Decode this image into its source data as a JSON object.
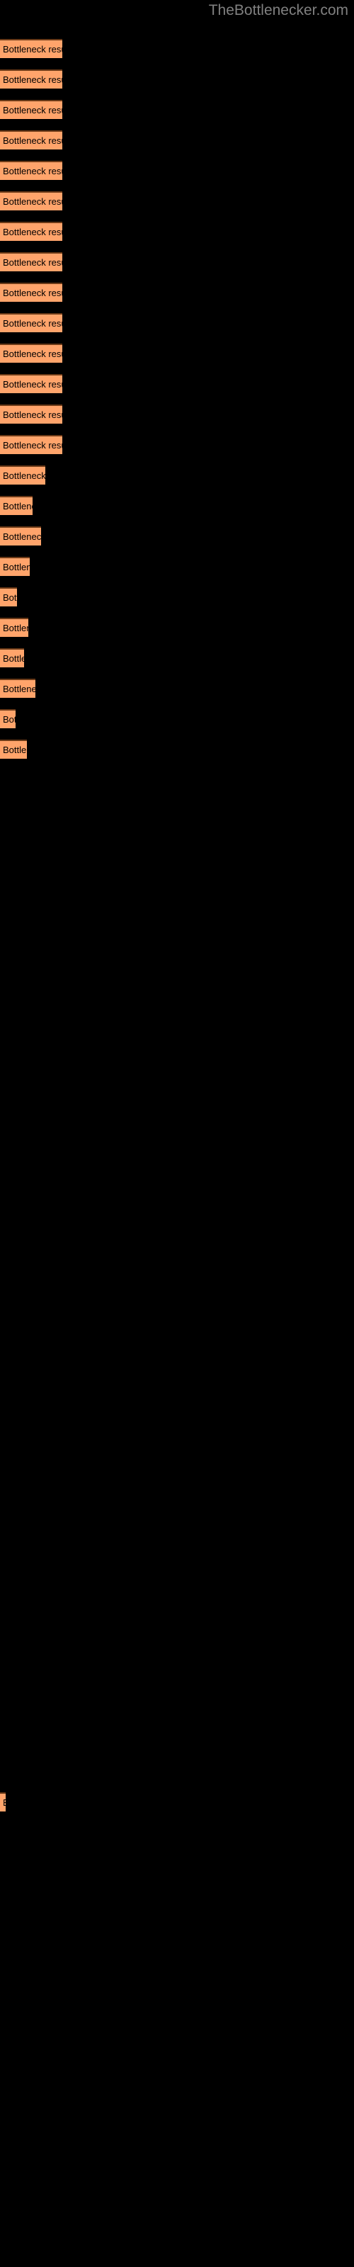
{
  "page": {
    "title": "TheBottlenecker.com",
    "background_color": "#000000",
    "bar_color": "#ffa46b",
    "bar_border_color": "#6b3a18",
    "title_color": "#808080",
    "label_color": "#000000"
  },
  "chart_data": {
    "type": "bar",
    "orientation": "horizontal",
    "title": "TheBottlenecker.com",
    "xlabel": "",
    "ylabel": "",
    "grid": false,
    "legend": false,
    "bar_label_text": "Bottleneck result",
    "categories": [
      "Bottleneck result",
      "Bottleneck result",
      "Bottleneck result",
      "Bottleneck result",
      "Bottleneck result",
      "Bottleneck result",
      "Bottleneck result",
      "Bottleneck result",
      "Bottleneck result",
      "Bottleneck result",
      "Bottleneck result",
      "Bottleneck result",
      "Bottleneck result",
      "Bottleneck result",
      "Bottleneck result",
      "Bottleneck result",
      "Bottleneck result",
      "Bottleneck result",
      "Bottleneck result",
      "Bottleneck result",
      "Bottleneck result",
      "Bottleneck result",
      "Bottleneck result",
      "Bottleneck result",
      "Bottleneck result"
    ],
    "values": [
      88,
      88,
      88,
      88,
      88,
      88,
      88,
      88,
      88,
      88,
      88,
      88,
      88,
      88,
      64,
      46,
      58,
      42,
      24,
      40,
      34,
      50,
      22,
      38,
      8
    ],
    "xlim": [
      0,
      500
    ],
    "bars": [
      {
        "y": 55,
        "width": 88,
        "label": "Bottleneck result"
      },
      {
        "y": 98,
        "width": 88,
        "label": "Bottleneck result"
      },
      {
        "y": 141,
        "width": 88,
        "label": "Bottleneck result"
      },
      {
        "y": 184,
        "width": 88,
        "label": "Bottleneck result"
      },
      {
        "y": 227,
        "width": 88,
        "label": "Bottleneck result"
      },
      {
        "y": 270,
        "width": 88,
        "label": "Bottleneck result"
      },
      {
        "y": 313,
        "width": 88,
        "label": "Bottleneck result"
      },
      {
        "y": 356,
        "width": 88,
        "label": "Bottleneck result"
      },
      {
        "y": 399,
        "width": 88,
        "label": "Bottleneck result"
      },
      {
        "y": 442,
        "width": 88,
        "label": "Bottleneck result"
      },
      {
        "y": 485,
        "width": 88,
        "label": "Bottleneck result"
      },
      {
        "y": 528,
        "width": 88,
        "label": "Bottleneck result"
      },
      {
        "y": 571,
        "width": 88,
        "label": "Bottleneck result"
      },
      {
        "y": 614,
        "width": 88,
        "label": "Bottleneck result"
      },
      {
        "y": 657,
        "width": 64,
        "label": "Bottleneck result"
      },
      {
        "y": 700,
        "width": 46,
        "label": "Bottleneck result"
      },
      {
        "y": 743,
        "width": 58,
        "label": "Bottleneck result"
      },
      {
        "y": 786,
        "width": 42,
        "label": "Bottleneck result"
      },
      {
        "y": 829,
        "width": 24,
        "label": "Bottleneck result"
      },
      {
        "y": 872,
        "width": 40,
        "label": "Bottleneck result"
      },
      {
        "y": 915,
        "width": 34,
        "label": "Bottleneck result"
      },
      {
        "y": 958,
        "width": 50,
        "label": "Bottleneck result"
      },
      {
        "y": 1001,
        "width": 22,
        "label": "Bottleneck result"
      },
      {
        "y": 1044,
        "width": 38,
        "label": "Bottleneck result"
      },
      {
        "y": 2530,
        "width": 8,
        "label": "Bottleneck result"
      }
    ]
  }
}
